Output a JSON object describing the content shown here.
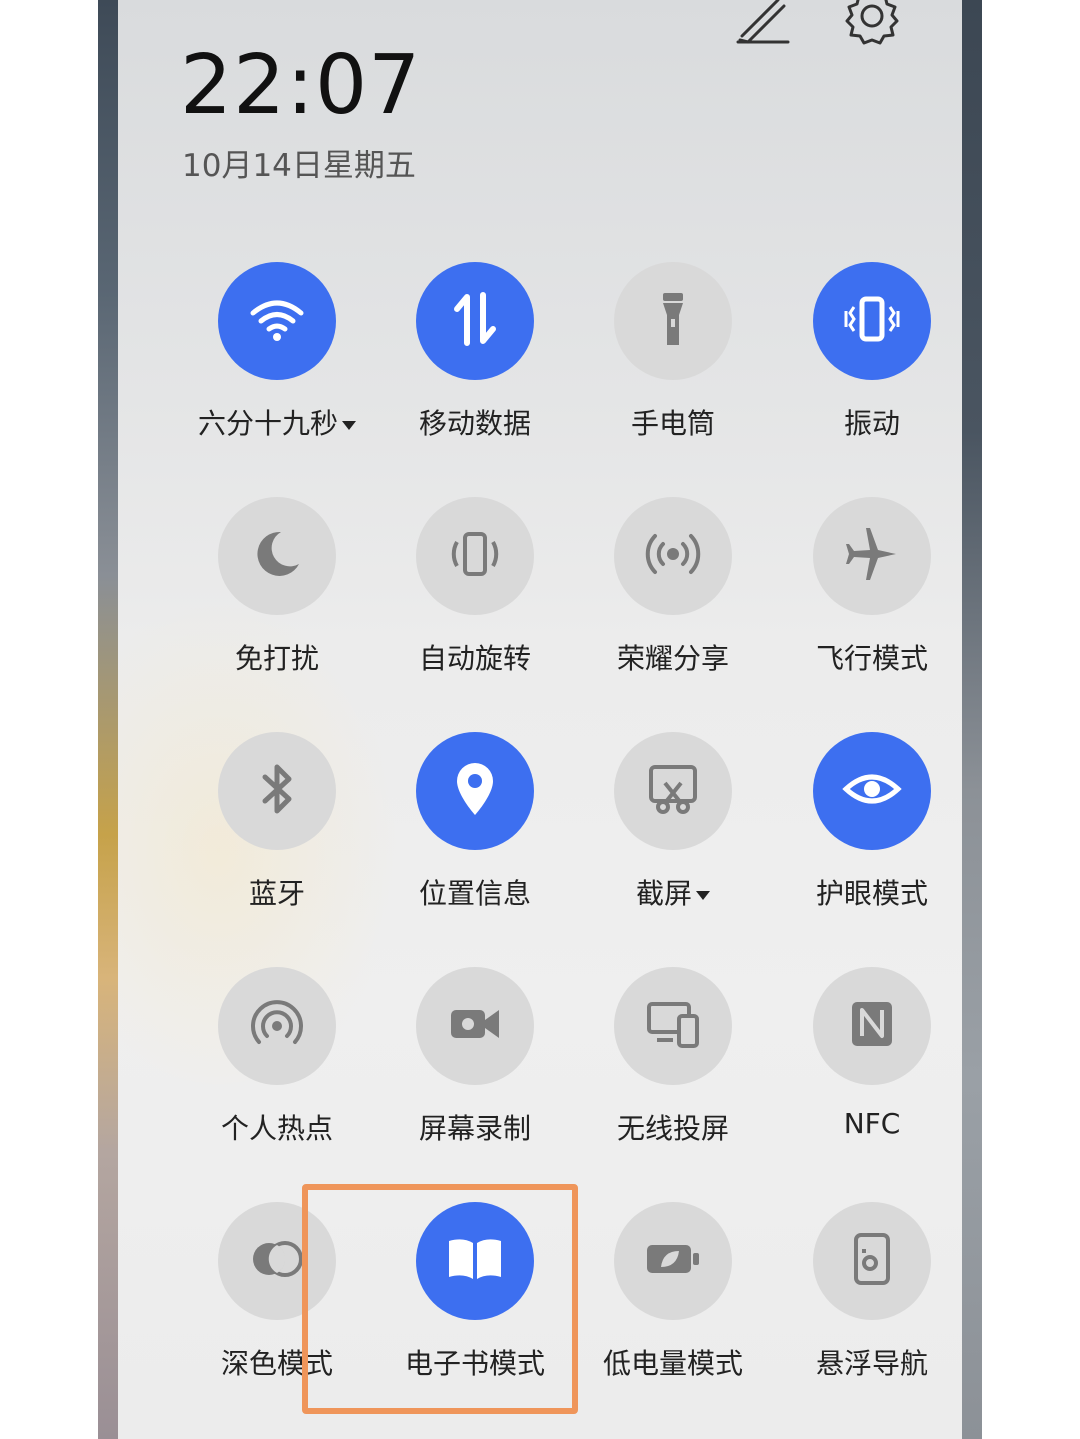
{
  "status": {
    "time": "22:07",
    "date": "10月14日星期五"
  },
  "header": {
    "edit_icon": "pencil-icon",
    "settings_icon": "gear-icon"
  },
  "colors": {
    "active_tile": "#3d6ff0",
    "inactive_tile": "#d9d9d9",
    "highlight_box": "#ef955a"
  },
  "tiles": [
    {
      "label": "六分十九秒",
      "icon": "wifi-icon",
      "active": true,
      "dropdown": true
    },
    {
      "label": "移动数据",
      "icon": "mobile-data-icon",
      "active": true,
      "dropdown": false
    },
    {
      "label": "手电筒",
      "icon": "flashlight-icon",
      "active": false,
      "dropdown": false
    },
    {
      "label": "振动",
      "icon": "vibrate-icon",
      "active": true,
      "dropdown": false
    },
    {
      "label": "免打扰",
      "icon": "moon-icon",
      "active": false,
      "dropdown": false
    },
    {
      "label": "自动旋转",
      "icon": "auto-rotate-icon",
      "active": false,
      "dropdown": false
    },
    {
      "label": "荣耀分享",
      "icon": "share-wireless-icon",
      "active": false,
      "dropdown": false
    },
    {
      "label": "飞行模式",
      "icon": "airplane-icon",
      "active": false,
      "dropdown": false
    },
    {
      "label": "蓝牙",
      "icon": "bluetooth-icon",
      "active": false,
      "dropdown": false
    },
    {
      "label": "位置信息",
      "icon": "location-pin-icon",
      "active": true,
      "dropdown": false
    },
    {
      "label": "截屏",
      "icon": "screenshot-icon",
      "active": false,
      "dropdown": true
    },
    {
      "label": "护眼模式",
      "icon": "eye-icon",
      "active": true,
      "dropdown": false
    },
    {
      "label": "个人热点",
      "icon": "hotspot-icon",
      "active": false,
      "dropdown": false
    },
    {
      "label": "屏幕录制",
      "icon": "video-camera-icon",
      "active": false,
      "dropdown": false
    },
    {
      "label": "无线投屏",
      "icon": "cast-screen-icon",
      "active": false,
      "dropdown": false
    },
    {
      "label": "NFC",
      "icon": "nfc-icon",
      "active": false,
      "dropdown": false
    },
    {
      "label": "深色模式",
      "icon": "dark-mode-icon",
      "active": false,
      "dropdown": false
    },
    {
      "label": "电子书模式",
      "icon": "open-book-icon",
      "active": true,
      "dropdown": false
    },
    {
      "label": "低电量模式",
      "icon": "battery-leaf-icon",
      "active": false,
      "dropdown": false
    },
    {
      "label": "悬浮导航",
      "icon": "floating-nav-icon",
      "active": false,
      "dropdown": false
    }
  ]
}
